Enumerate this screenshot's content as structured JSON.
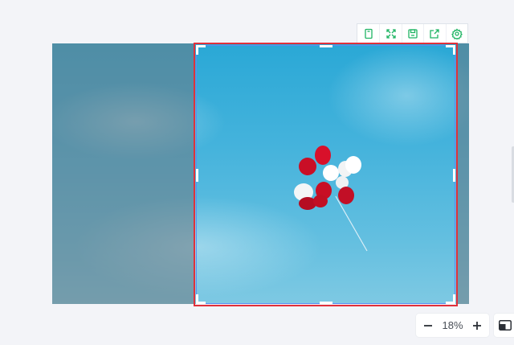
{
  "toolbar": {
    "icons": [
      "copy-icon",
      "fullscreen-icon",
      "save-icon",
      "export-icon",
      "settings-icon"
    ],
    "accent_color": "#1fb463"
  },
  "canvas": {
    "crop_border_color": "#e0313b",
    "image_description": null
  },
  "zoom": {
    "minus_label": "−",
    "value": "18%",
    "plus_label": "+"
  },
  "panel_toggle": {
    "icon": "sidebar-panel-icon"
  }
}
